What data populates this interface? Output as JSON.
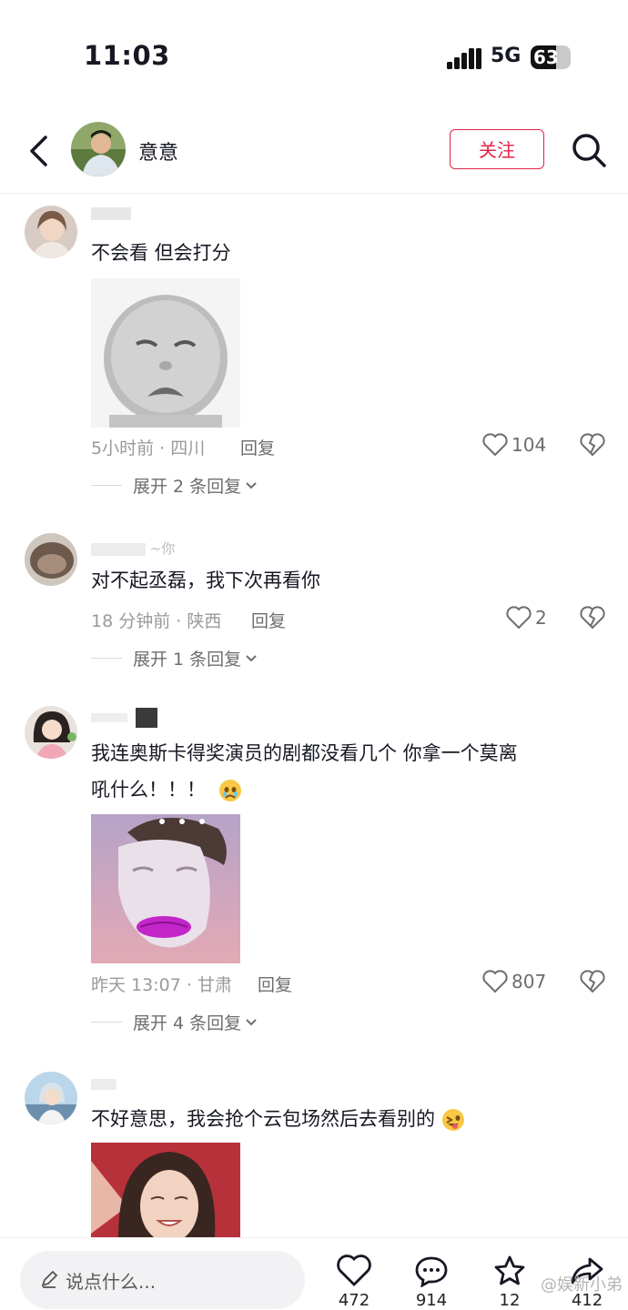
{
  "status": {
    "time": "11:03",
    "network": "5G",
    "battery": "63",
    "battery_level": 0.63
  },
  "header": {
    "name": "意意",
    "follow_label": "关注"
  },
  "comments": [
    {
      "text": "不会看 但会打分",
      "meta": "5小时前 · 四川",
      "reply_label": "回复",
      "likes": "104",
      "expand": "展开 2 条回复"
    },
    {
      "username_fragment": "~你",
      "text": "对不起丞磊，我下次再看你",
      "meta": "18 分钟前 · 陕西",
      "reply_label": "回复",
      "likes": "2",
      "expand": "展开 1 条回复"
    },
    {
      "text_line1": "我连奥斯卡得奖演员的剧都没看几个  你拿一个莫离",
      "text_line2": "吼什么！！！",
      "emoji": "crying-face",
      "meta": "昨天 13:07 · 甘肃",
      "reply_label": "回复",
      "likes": "807",
      "expand": "展开 4 条回复"
    },
    {
      "text": "不好意思，我会抢个云包场然后去看别的",
      "emoji": "winking-tongue-face"
    }
  ],
  "bottom": {
    "placeholder": "说点什么...",
    "like_count": "472",
    "comment_count": "914",
    "fav_count": "12",
    "share_count": "412",
    "watermark": "@娱新小弟"
  }
}
